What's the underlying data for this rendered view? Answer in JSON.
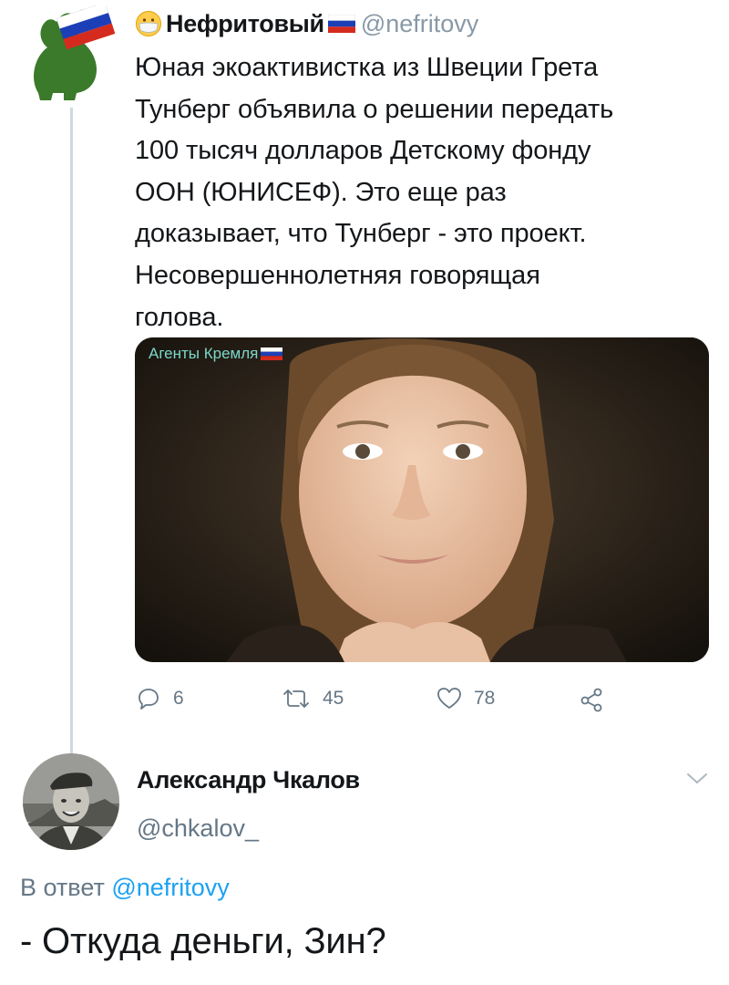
{
  "tweet1": {
    "author_name": "Нефритовый",
    "handle": "@nefritovy",
    "text": "Юная экоактивистка из Швеции Грета\nТунберг объявила о решении передать\n100 тысяч долларов Детскому фонду\nООН (ЮНИСЕФ). Это еще раз\nдоказывает, что Тунберг - это проект.\nНесовершеннолетняя говорящая\nголова.",
    "media_watermark": "Агенты Кремля",
    "reply_count": "6",
    "retweet_count": "45",
    "like_count": "78",
    "icons": [
      "reply-icon",
      "retweet-icon",
      "like-icon",
      "share-icon"
    ]
  },
  "tweet2": {
    "author_name": "Александр Чкалов",
    "handle": "@chkalov_",
    "reply_label": "В ответ",
    "reply_to_handle": "@nefritovy",
    "text": "- Откуда деньги, Зин?"
  },
  "colors": {
    "handle_gray": "#8899a6",
    "link_blue": "#1da1f2",
    "thread_line": "#cfd9de",
    "avatar_green": "#3b7a2a",
    "watermark": "#7ad7c8"
  }
}
